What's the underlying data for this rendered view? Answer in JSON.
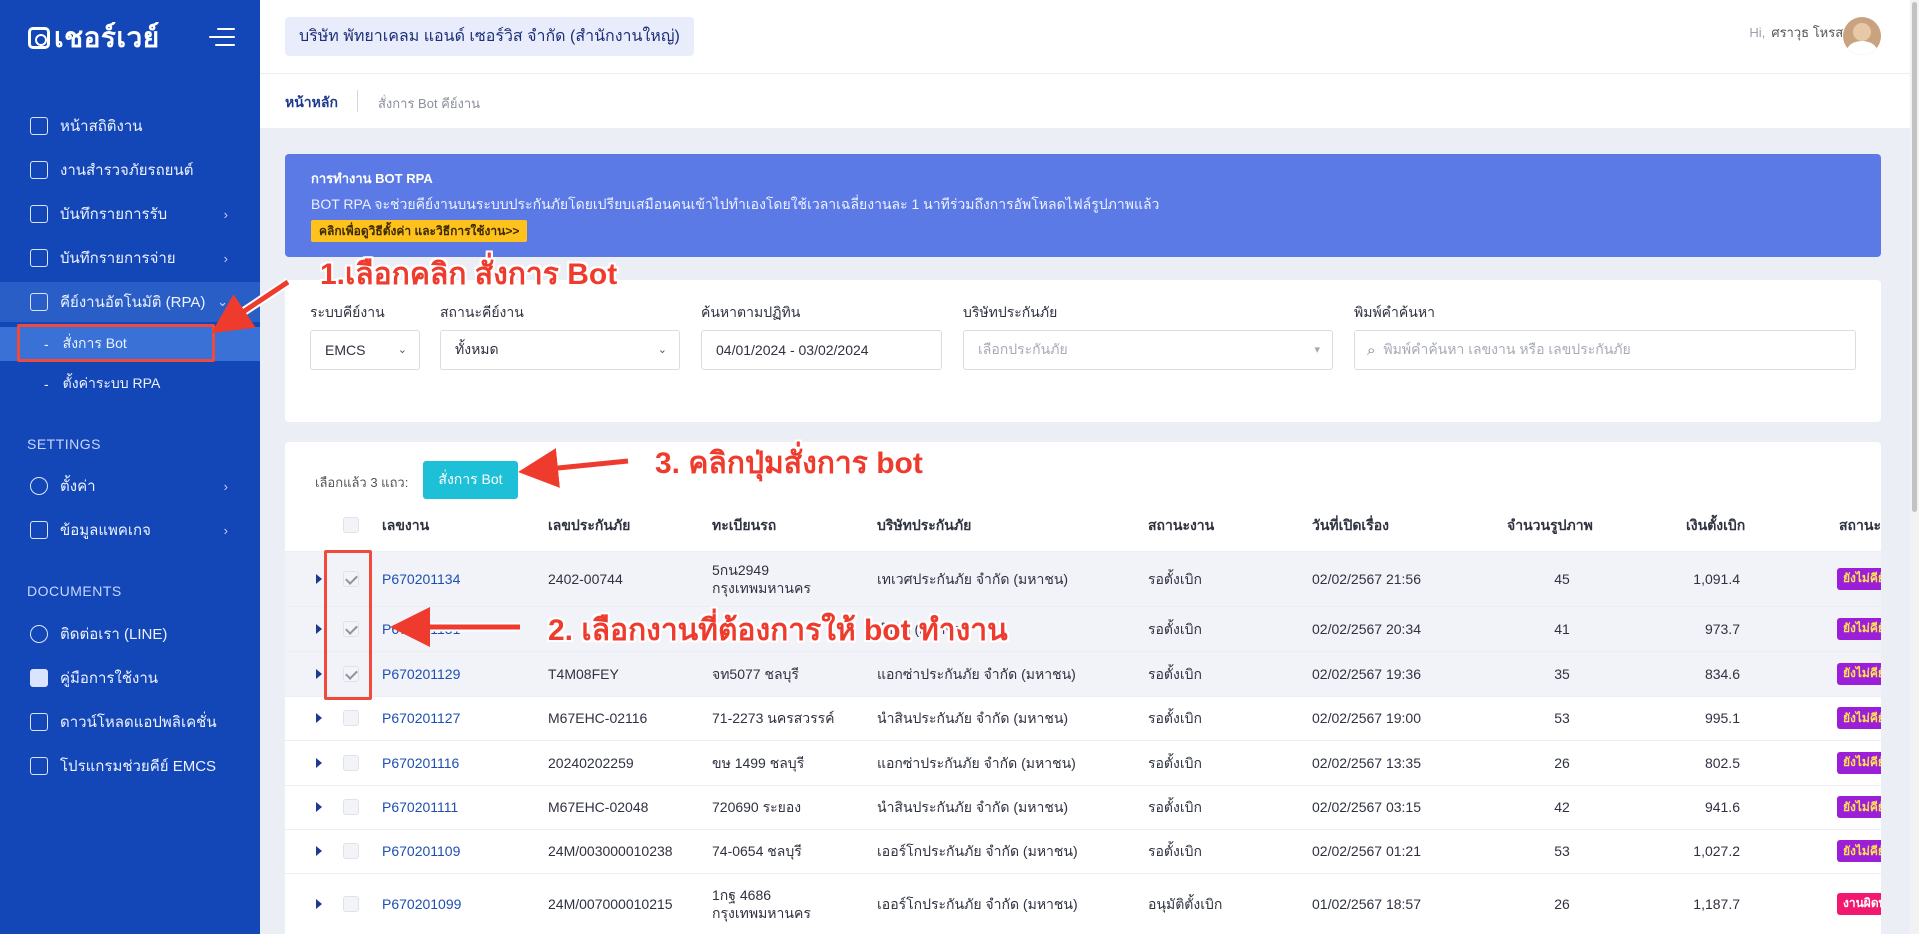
{
  "sidebar": {
    "brand": "เชอร์เวย์",
    "menu": [
      {
        "label": "หน้าสถิติงาน",
        "icon": "bar-chart-icon",
        "has_arrow": false
      },
      {
        "label": "งานสำรวจภัยรถยนต์",
        "icon": "calendar-check-icon",
        "has_arrow": false
      },
      {
        "label": "บันทึกรายการรับ",
        "icon": "copy-icon",
        "has_arrow": true
      },
      {
        "label": "บันทึกรายการจ่าย",
        "icon": "list-icon",
        "has_arrow": true
      },
      {
        "label": "คีย์งานอัตโนมัติ (RPA)",
        "icon": "rocket-icon",
        "has_arrow": true
      }
    ],
    "submenu": [
      {
        "label": "สั่งการ Bot"
      },
      {
        "label": "ตั้งค่าระบบ RPA"
      }
    ],
    "settings_label": "SETTINGS",
    "settings_items": [
      {
        "label": "ตั้งค่า",
        "icon": "gear-icon"
      },
      {
        "label": "ข้อมูลแพคเกจ",
        "icon": "gift-icon"
      }
    ],
    "documents_label": "DOCUMENTS",
    "document_items": [
      {
        "label": "ติดต่อเรา (LINE)",
        "icon": "chat-icon"
      },
      {
        "label": "คู่มือการใช้งาน",
        "icon": "book-icon"
      },
      {
        "label": "ดาวน์โหลดแอปพลิเคชั่น",
        "icon": "download-icon"
      },
      {
        "label": "โปรแกรมช่วยคีย์ EMCS",
        "icon": "download-icon"
      }
    ]
  },
  "header": {
    "company": "บริษัท พัทยาเคลม แอนด์ เซอร์วิส จำกัด (สำนักงานใหญ่)",
    "greeting": "Hi,",
    "user_name": "ศราวุธ โหรสกุล"
  },
  "breadcrumb": {
    "home": "หน้าหลัก",
    "current": "สั่งการ Bot คีย์งาน"
  },
  "banner": {
    "title": "การทำงาน BOT RPA",
    "text": "BOT RPA จะช่วยคีย์งานบนระบบประกันภัยโดยเปรียบเสมือนคนเข้าไปทำเองโดยใช้เวลาเฉลี่ยงานละ 1 นาทีร่วมถึงการอัพโหลดไฟล์รูปภาพแล้ว",
    "link": "คลิกเพื่อดูวิธีตั้งค่า และวิธีการใช้งาน>>"
  },
  "filters": {
    "system_label": "ระบบคีย์งาน",
    "system_value": "EMCS",
    "status_label": "สถานะคีย์งาน",
    "status_value": "ทั้งหมด",
    "date_label": "ค้นหาตามปฏิทิน",
    "date_value": "04/01/2024 - 03/02/2024",
    "insurer_label": "บริษัทประกันภัย",
    "insurer_placeholder": "เลือกประกันภัย",
    "search_label": "พิมพ์คำค้นหา",
    "search_placeholder": "พิมพ์คำค้นหา เลขงาน หรือ เลขประกันภัย"
  },
  "toolbar": {
    "selected_text": "เลือกแล้ว 3 แถว:",
    "bot_button": "สั่งการ Bot"
  },
  "table": {
    "columns": [
      "เลขงาน",
      "เลขประกันภัย",
      "ทะเบียนรถ",
      "บริษัทประกันภัย",
      "สถานะงาน",
      "วันที่เปิดเรื่อง",
      "จำนวนรูปภาพ",
      "เงินตั้งเบิก",
      "สถานะ"
    ],
    "rows": [
      {
        "job": "P670201134",
        "policy": "2402-00744",
        "plate": "5กน2949",
        "plate2": "กรุงเทพมหานคร",
        "insurer": "เทเวศประกันภัย จำกัด (มหาชน)",
        "status": "รอตั้งเบิก",
        "date": "02/02/2567 21:56",
        "photos": "45",
        "amount": "1,091.4",
        "badge": "ยังไม่คีย์",
        "checked": true
      },
      {
        "job": "P670201131",
        "policy": "",
        "plate": "",
        "plate2": "",
        "insurer": "จำกัด (มหาชน)",
        "status": "รอตั้งเบิก",
        "date": "02/02/2567 20:34",
        "photos": "41",
        "amount": "973.7",
        "badge": "ยังไม่คีย์",
        "checked": true
      },
      {
        "job": "P670201129",
        "policy": "T4M08FEY",
        "plate": "จท5077 ชลบุรี",
        "plate2": "",
        "insurer": "แอกซ่าประกันภัย จำกัด (มหาชน)",
        "status": "รอตั้งเบิก",
        "date": "02/02/2567 19:36",
        "photos": "35",
        "amount": "834.6",
        "badge": "ยังไม่คีย์",
        "checked": true
      },
      {
        "job": "P670201127",
        "policy": "M67EHC-02116",
        "plate": "71-2273 นครสวรรค์",
        "plate2": "",
        "insurer": "นำสินประกันภัย จำกัด (มหาชน)",
        "status": "รอตั้งเบิก",
        "date": "02/02/2567 19:00",
        "photos": "53",
        "amount": "995.1",
        "badge": "ยังไม่คีย์",
        "checked": false
      },
      {
        "job": "P670201116",
        "policy": "20240202259",
        "plate": "ขษ 1499 ชลบุรี",
        "plate2": "",
        "insurer": "แอกซ่าประกันภัย จำกัด (มหาชน)",
        "status": "รอตั้งเบิก",
        "date": "02/02/2567 13:35",
        "photos": "26",
        "amount": "802.5",
        "badge": "ยังไม่คีย์",
        "checked": false
      },
      {
        "job": "P670201111",
        "policy": "M67EHC-02048",
        "plate": "720690 ระยอง",
        "plate2": "",
        "insurer": "นำสินประกันภัย จำกัด (มหาชน)",
        "status": "รอตั้งเบิก",
        "date": "02/02/2567 03:15",
        "photos": "42",
        "amount": "941.6",
        "badge": "ยังไม่คีย์",
        "checked": false
      },
      {
        "job": "P670201109",
        "policy": "24M/003000010238",
        "plate": "74-0654 ชลบุรี",
        "plate2": "",
        "insurer": "เออร์โกประกันภัย จำกัด (มหาชน)",
        "status": "รอตั้งเบิก",
        "date": "02/02/2567 01:21",
        "photos": "53",
        "amount": "1,027.2",
        "badge": "ยังไม่คีย์",
        "checked": false
      },
      {
        "job": "P670201099",
        "policy": "24M/007000010215",
        "plate": "1กฐ 4686",
        "plate2": "กรุงเทพมหานคร",
        "insurer": "เออร์โกประกันภัย จำกัด (มหาชน)",
        "status": "อนุมัติตั้งเบิก",
        "date": "01/02/2567 18:57",
        "photos": "26",
        "amount": "1,187.7",
        "badge": "งานผิดพลาด",
        "checked": false
      }
    ]
  },
  "annotations": {
    "step1": "1.เลือกคลิก สั่งการ Bot",
    "step2": "2. เลือกงานที่ต้องการให้ bot ทำงาน",
    "step3": "3. คลิกปุ่มสั่งการ bot"
  },
  "colors": {
    "sidebar": "#1346b7",
    "banner": "#5b7ae6",
    "bot_button": "#1ec0d8",
    "annotation": "#ef3b2d",
    "badge_pending": "#9b1fd8",
    "badge_error": "#f2186f"
  }
}
